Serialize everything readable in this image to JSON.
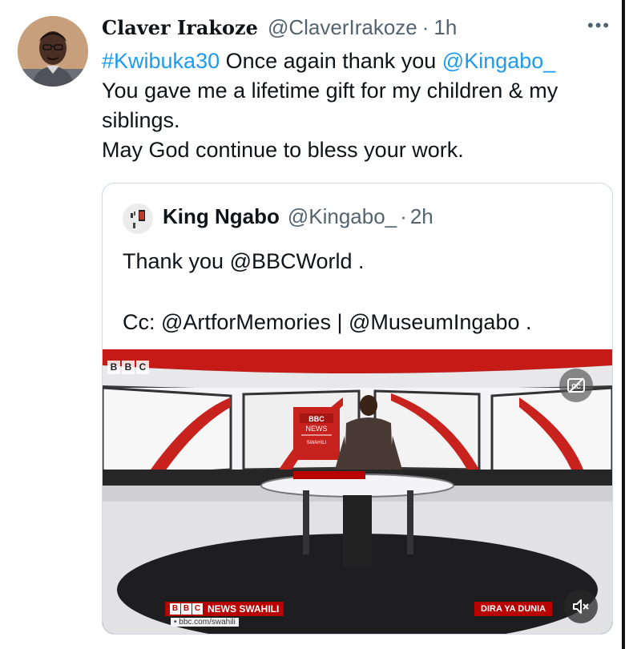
{
  "tweet": {
    "display_name": "Claver Irakoze",
    "handle": "@ClaverIrakoze",
    "separator": "·",
    "time": "1h",
    "more_label": "•••",
    "hashtag": "#Kwibuka30",
    "line1_text": " Once again thank you ",
    "mention": "@Kingabo_",
    "line2": "You gave me a lifetime gift for my children & my siblings.",
    "line3": "May God continue to bless your work."
  },
  "quoted_tweet": {
    "display_name": "King Ngabo",
    "handle": "@Kingabo_",
    "separator": "·",
    "time": "2h",
    "line1": "Thank you @BBCWorld .",
    "line2": "Cc: @ArtforMemories | @MuseumIngabo ."
  },
  "video": {
    "corner_logo": [
      "B",
      "B",
      "C"
    ],
    "desk_logo_line1": "BBC",
    "desk_logo_line2": "NEWS",
    "desk_logo_line3": "SWAHILI",
    "lower_third_logo": [
      "B",
      "B",
      "C"
    ],
    "lower_third_text": "NEWS  SWAHILI",
    "lower_third_url": "• bbc.com/swahili",
    "lower_third_right": "DIRA YA DUNIA"
  },
  "colors": {
    "link": "#1d9bf0",
    "muted": "#536471",
    "bbc_red": "#b80000"
  },
  "icons": [
    "more-icon",
    "captions-icon",
    "mute-icon"
  ]
}
